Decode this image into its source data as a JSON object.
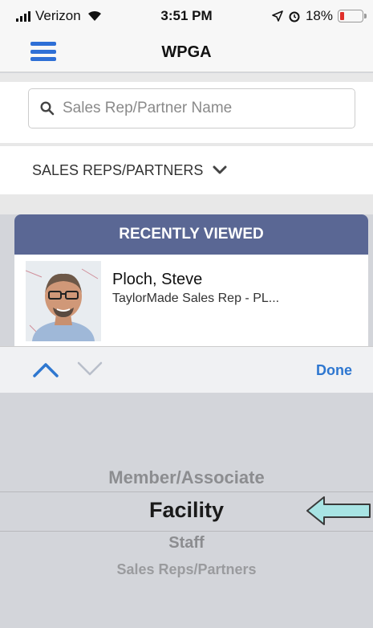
{
  "status_bar": {
    "carrier": "Verizon",
    "time": "3:51 PM",
    "battery": "18%",
    "battery_level": 0.18,
    "battery_color": "#e0302b",
    "icons": [
      "signal-icon",
      "wifi-icon",
      "location-icon",
      "alarm-icon",
      "battery-icon"
    ]
  },
  "nav": {
    "title": "WPGA",
    "menu_icon": "hamburger-menu-icon",
    "accent_color": "#2e6fd6"
  },
  "search": {
    "placeholder": "Sales Rep/Partner Name",
    "value": "",
    "icon": "search-icon"
  },
  "filter": {
    "label": "SALES REPS/PARTNERS",
    "icon": "chevron-down-icon"
  },
  "recent": {
    "header": "RECENTLY VIEWED",
    "header_color": "#5a6794",
    "items": [
      {
        "name": "Ploch, Steve",
        "subtitle": "TaylorMade Sales Rep - PL..."
      }
    ]
  },
  "toolbar": {
    "done_label": "Done",
    "prev_icon": "chevron-up-icon",
    "next_icon": "chevron-down-icon"
  },
  "picker": {
    "options": [
      "Member/Associate",
      "Facility",
      "Staff",
      "Sales Reps/Partners"
    ],
    "selected": "Facility"
  }
}
